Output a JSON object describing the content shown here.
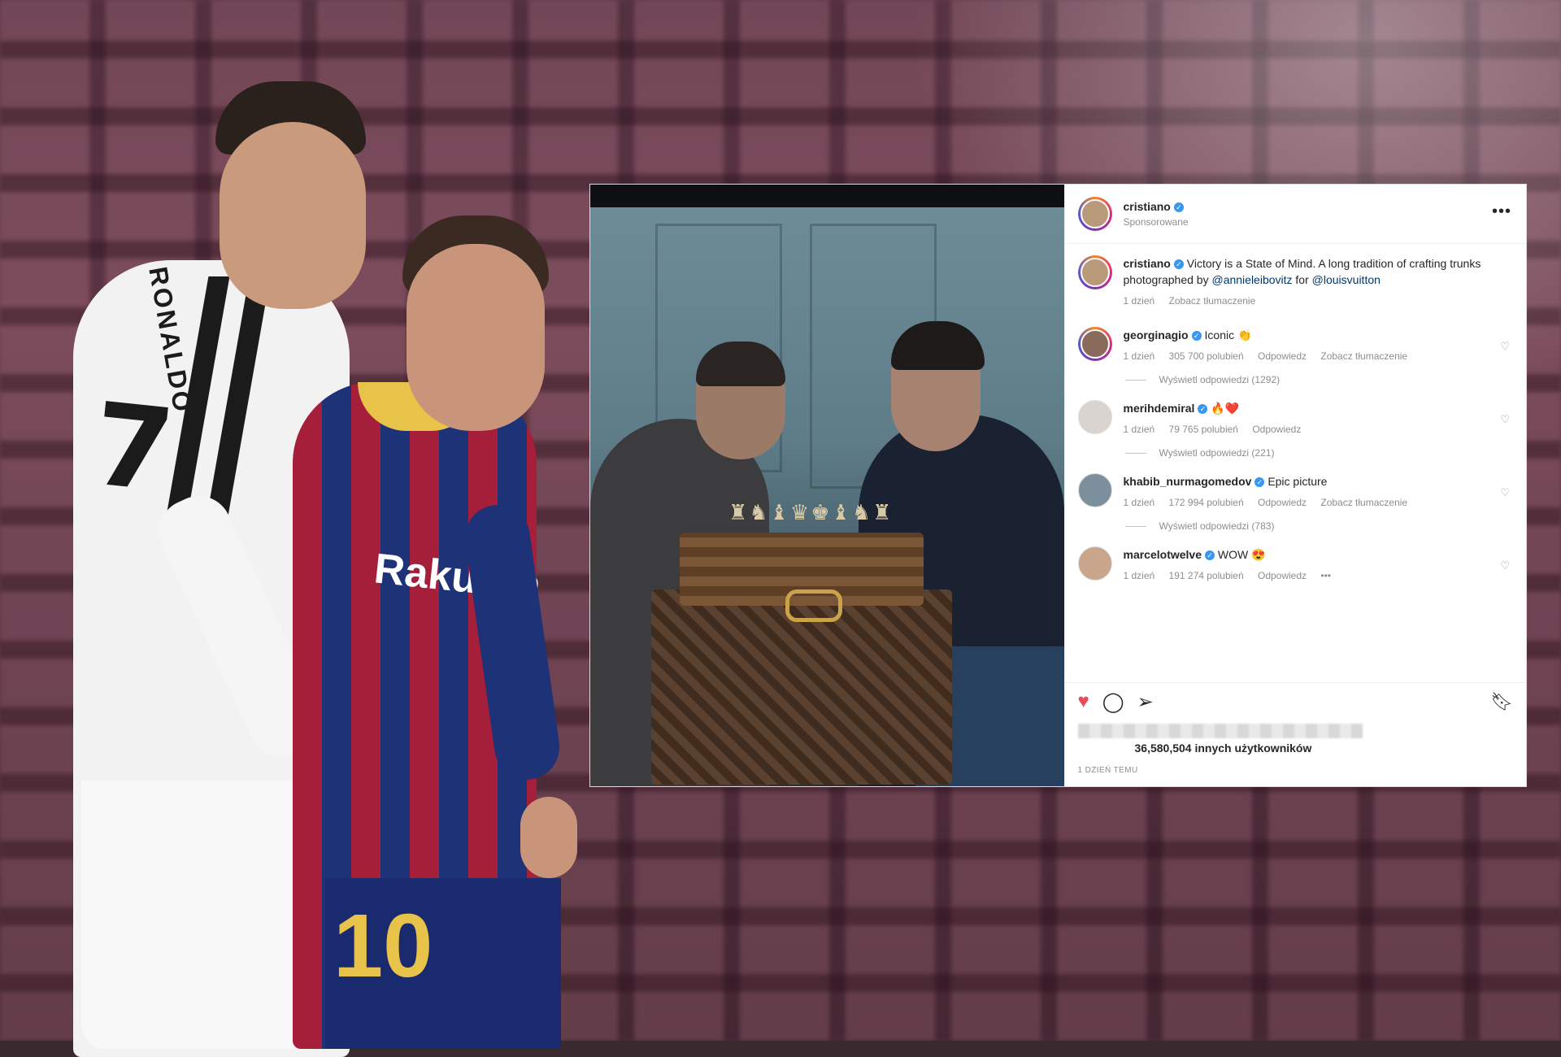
{
  "background": {
    "player_left_name": "RONALDO",
    "player_left_number": "7",
    "player_right_sponsor": "Rakuten",
    "player_right_number": "10"
  },
  "post": {
    "username": "cristiano",
    "sponsored_label": "Sponsorowane",
    "more_icon": "more-icon",
    "caption": {
      "username": "cristiano",
      "text_before": " Victory is a State of Mind. A long tradition of crafting trunks photographed by ",
      "mention1": "@annieleibovitz",
      "text_mid": " for ",
      "mention2": "@louisvuitton",
      "time": "1 dzień",
      "translate": "Zobacz tłumaczenie"
    },
    "comments": [
      {
        "user": "georginagio",
        "text": "Iconic 👏",
        "time": "1 dzień",
        "likes": "305 700 polubień",
        "reply": "Odpowiedz",
        "translate": "Zobacz tłumaczenie",
        "replies": "Wyświetl odpowiedzi (1292)"
      },
      {
        "user": "merihdemiral",
        "text": "🔥❤️",
        "time": "1 dzień",
        "likes": "79 765 polubień",
        "reply": "Odpowiedz",
        "translate": "",
        "replies": "Wyświetl odpowiedzi (221)"
      },
      {
        "user": "khabib_nurmagomedov",
        "text": "Epic picture",
        "time": "1 dzień",
        "likes": "172 994 polubień",
        "reply": "Odpowiedz",
        "translate": "Zobacz tłumaczenie",
        "replies": "Wyświetl odpowiedzi (783)"
      },
      {
        "user": "marcelotwelve",
        "text": "WOW 😍",
        "time": "1 dzień",
        "likes": "191 274 polubień",
        "reply": "Odpowiedz",
        "translate": "•••",
        "replies": ""
      }
    ],
    "likes_text": "36,580,504 innych użytkowników",
    "timestamp": "1 DZIEŃ TEMU",
    "colors": {
      "accent_blue": "#3897f0",
      "like_red": "#ed4956"
    }
  }
}
